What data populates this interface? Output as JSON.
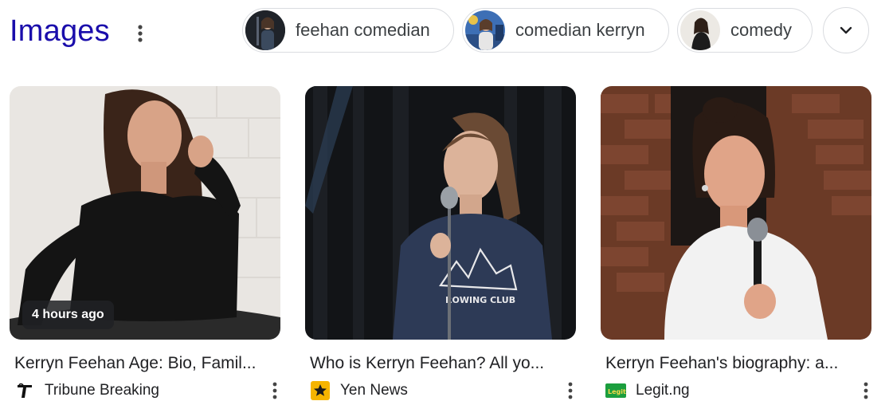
{
  "header": {
    "title": "Images",
    "menu_icon": "more-vert-icon"
  },
  "chips": [
    {
      "label": "feehan comedian",
      "thumb_icon": "person-thumbnail"
    },
    {
      "label": "comedian kerryn",
      "thumb_icon": "person-thumbnail"
    },
    {
      "label": "comedy",
      "thumb_icon": "person-thumbnail"
    }
  ],
  "expand_icon": "chevron-down-icon",
  "cards": [
    {
      "title": "Kerryn Feehan Age: Bio, Famil...",
      "source": "Tribune Breaking",
      "source_icon": "tribune-logo-icon",
      "badge": "4 hours ago"
    },
    {
      "title": "Who is Kerryn Feehan? All yo...",
      "source": "Yen News",
      "source_icon": "yen-star-icon"
    },
    {
      "title": "Kerryn Feehan's biography: a...",
      "source": "Legit.ng",
      "source_icon": "legit-logo-icon"
    }
  ],
  "colors": {
    "title_blue": "#1a0dab",
    "chip_border": "#dadce0",
    "yen_gold": "#f5b400",
    "legit_green": "#1b9e3e"
  }
}
